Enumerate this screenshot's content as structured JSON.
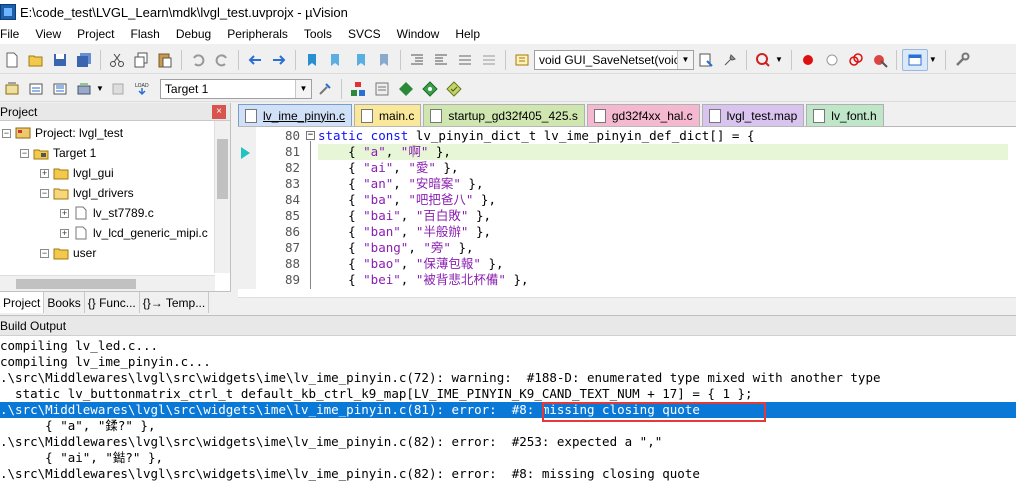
{
  "window": {
    "title": "E:\\code_test\\LVGL_Learn\\mdk\\lvgl_test.uvprojx - µVision"
  },
  "menu": [
    "File",
    "View",
    "Project",
    "Flash",
    "Debug",
    "Peripherals",
    "Tools",
    "SVCS",
    "Window",
    "Help"
  ],
  "toolbar1": {
    "function_combo": "void GUI_SaveNetset(voic"
  },
  "toolbar2": {
    "target_combo": "Target 1"
  },
  "project_pane": {
    "title": "Project",
    "tree": [
      {
        "label": "Project: lvgl_test",
        "icon": "project-icon"
      },
      {
        "label": "Target 1",
        "icon": "target-icon"
      },
      {
        "label": "lvgl_gui",
        "icon": "folder-icon"
      },
      {
        "label": "lvgl_drivers",
        "icon": "folder-icon"
      },
      {
        "label": "lv_st7789.c",
        "icon": "file-icon"
      },
      {
        "label": "lv_lcd_generic_mipi.c",
        "icon": "file-icon"
      },
      {
        "label": "user",
        "icon": "folder-icon"
      }
    ],
    "bottom_tabs": [
      "Project",
      "Books",
      "{} Func...",
      "{}→ Temp..."
    ]
  },
  "editor": {
    "tabs": [
      {
        "label": "lv_ime_pinyin.c",
        "color": "#cfe0f7"
      },
      {
        "label": "main.c",
        "color": "#f9e79a"
      },
      {
        "label": "startup_gd32f405_425.s",
        "color": "#cfe6b0"
      },
      {
        "label": "gd32f4xx_hal.c",
        "color": "#f4b8d0"
      },
      {
        "label": "lvgl_test.map",
        "color": "#d9c3ef"
      },
      {
        "label": "lv_font.h",
        "color": "#bfe6c8"
      }
    ],
    "lines": [
      {
        "num": "80",
        "pre": "",
        "kw": "static const",
        "rest": " lv_pinyin_dict_t lv_ime_pinyin_def_dict[] = {"
      },
      {
        "num": "81",
        "key": "\"a\"",
        "val": "\"啊\""
      },
      {
        "num": "82",
        "key": "\"ai\"",
        "val": "\"愛\""
      },
      {
        "num": "83",
        "key": "\"an\"",
        "val": "\"安暗案\""
      },
      {
        "num": "84",
        "key": "\"ba\"",
        "val": "\"吧把爸八\""
      },
      {
        "num": "85",
        "key": "\"bai\"",
        "val": "\"百白敗\""
      },
      {
        "num": "86",
        "key": "\"ban\"",
        "val": "\"半般辦\""
      },
      {
        "num": "87",
        "key": "\"bang\"",
        "val": "\"旁\""
      },
      {
        "num": "88",
        "key": "\"bao\"",
        "val": "\"保薄包報\""
      },
      {
        "num": "89",
        "key": "\"bei\"",
        "val": "\"被背悲北杯備\""
      }
    ]
  },
  "build": {
    "title": "Build Output",
    "lines": [
      "compiling lv_led.c...",
      "compiling lv_ime_pinyin.c...",
      ".\\src\\Middlewares\\lvgl\\src\\widgets\\ime\\lv_ime_pinyin.c(72): warning:  #188-D: enumerated type mixed with another type",
      "  static lv_buttonmatrix_ctrl_t default_kb_ctrl_k9_map[LV_IME_PINYIN_K9_CAND_TEXT_NUM + 17] = { 1 };",
      ".\\src\\Middlewares\\lvgl\\src\\widgets\\ime\\lv_ime_pinyin.c(81): error:  #8: missing closing quote",
      "      { \"a\", \"鍒?\" },",
      ".\\src\\Middlewares\\lvgl\\src\\widgets\\ime\\lv_ime_pinyin.c(82): error:  #253: expected a \",\"",
      "      { \"ai\", \"鐑?\" },",
      ".\\src\\Middlewares\\lvgl\\src\\widgets\\ime\\lv_ime_pinyin.c(82): error:  #8: missing closing quote"
    ]
  }
}
